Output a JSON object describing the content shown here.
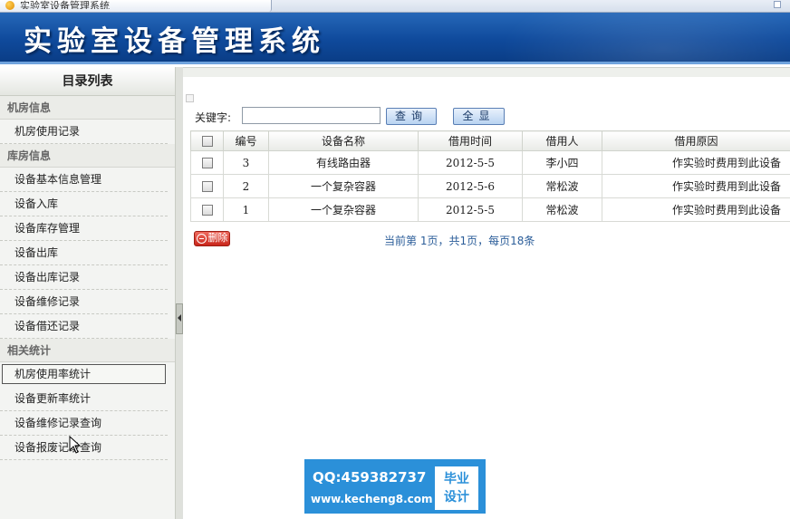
{
  "browser": {
    "tab_title": "实验室设备管理系统"
  },
  "banner": {
    "title": "实验室设备管理系统"
  },
  "sidebar": {
    "header": "目录列表",
    "groups": [
      {
        "label": "机房信息",
        "items": [
          {
            "label": "机房使用记录"
          }
        ]
      },
      {
        "label": "库房信息",
        "items": [
          {
            "label": "设备基本信息管理"
          },
          {
            "label": "设备入库"
          },
          {
            "label": "设备库存管理"
          },
          {
            "label": "设备出库"
          },
          {
            "label": "设备出库记录"
          },
          {
            "label": "设备维修记录"
          },
          {
            "label": "设备借还记录"
          }
        ]
      },
      {
        "label": "相关统计",
        "items": [
          {
            "label": "机房使用率统计",
            "selected": true
          },
          {
            "label": "设备更新率统计"
          },
          {
            "label": "设备维修记录查询"
          },
          {
            "label": "设备报废记录查询"
          }
        ]
      }
    ]
  },
  "search": {
    "label": "关键字:",
    "value": "",
    "placeholder": "",
    "query_button": "查询",
    "show_all_button": "全显"
  },
  "table": {
    "columns": [
      "编号",
      "设备名称",
      "借用时间",
      "借用人",
      "借用原因"
    ],
    "rows": [
      {
        "id": "3",
        "name": "有线路由器",
        "time": "2012-5-5",
        "person": "李小四",
        "reason": "作实验时费用到此设备"
      },
      {
        "id": "2",
        "name": "一个复杂容器",
        "time": "2012-5-6",
        "person": "常松波",
        "reason": "作实验时费用到此设备"
      },
      {
        "id": "1",
        "name": "一个复杂容器",
        "time": "2012-5-5",
        "person": "常松波",
        "reason": "作实验时费用到此设备"
      }
    ]
  },
  "actions": {
    "delete_button": "删除"
  },
  "pager": {
    "text": "当前第 1页，共1页，每页18条"
  },
  "watermark": {
    "qq": "QQ:459382737",
    "url": "www.kecheng8.com",
    "box_line1": "毕业",
    "box_line2": "设计"
  },
  "colors": {
    "banner": "#0f4a9c",
    "button": "#b9d3f1",
    "delete": "#c9261b",
    "watermark": "#2b90d9"
  }
}
